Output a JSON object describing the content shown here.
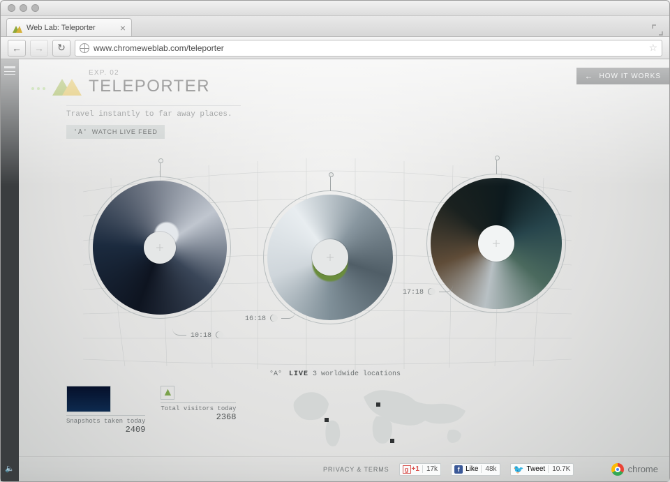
{
  "browser": {
    "tab_title": "Web Lab: Teleporter",
    "url": "www.chromeweblab.com/teleporter"
  },
  "header": {
    "exp_label": "EXP. 02",
    "title": "TELEPORTER",
    "tagline": "Travel instantly to far away places.",
    "watch_button": "WATCH LIVE FEED",
    "watch_icon": "'A'"
  },
  "how_it_works": "HOW IT WORKS",
  "locations": {
    "status_antenna": "°A°",
    "status_word": "LIVE",
    "status_sub": "3 worldwide locations",
    "times": {
      "loc1": "10:18",
      "loc2": "16:18",
      "loc3": "17:18"
    }
  },
  "stats": {
    "snapshots_label": "Snapshots taken today",
    "snapshots_value": "2409",
    "visitors_label": "Total visitors today",
    "visitors_value": "2368"
  },
  "footer": {
    "privacy": "PRIVACY & TERMS",
    "gplus_count": "17k",
    "fb_label": "Like",
    "fb_count": "48k",
    "tw_label": "Tweet",
    "tw_count": "10.7K",
    "chrome_label": "chrome"
  }
}
